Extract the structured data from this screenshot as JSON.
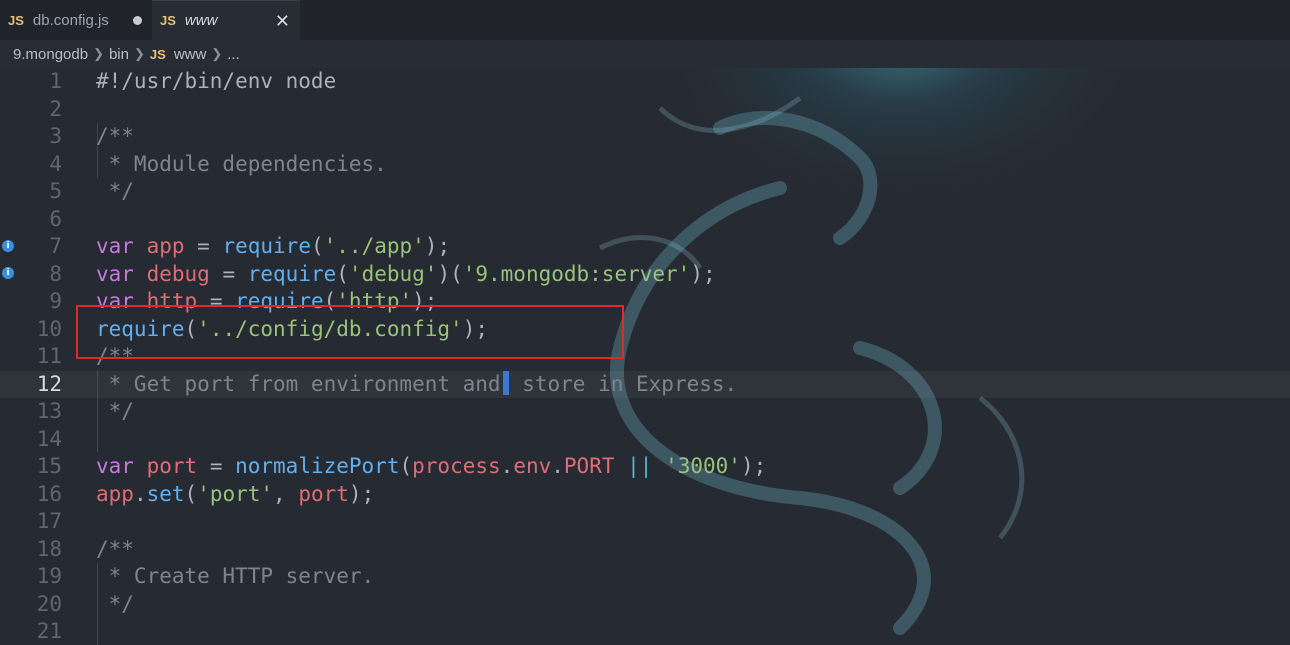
{
  "tabs": [
    {
      "badge": "JS",
      "label": "db.config.js",
      "dirty": true
    },
    {
      "badge": "JS",
      "label": "www",
      "active": true
    }
  ],
  "breadcrumb": {
    "items": [
      "9.mongodb",
      "bin",
      "www",
      "..."
    ],
    "file_badge": "JS"
  },
  "editor": {
    "current_line": 12,
    "lines": [
      {
        "n": "1",
        "text": "#!/usr/bin/env node"
      },
      {
        "n": "2",
        "text": ""
      },
      {
        "n": "3",
        "text": "/**"
      },
      {
        "n": "4",
        "text": " * Module dependencies."
      },
      {
        "n": "5",
        "text": " */"
      },
      {
        "n": "6",
        "text": ""
      },
      {
        "n": "7",
        "text": "var app = require('../app');"
      },
      {
        "n": "8",
        "text": "var debug = require('debug')('9.mongodb:server');"
      },
      {
        "n": "9",
        "text": "var http = require('http');"
      },
      {
        "n": "10",
        "text": "require('../config/db.config');"
      },
      {
        "n": "11",
        "text": "/**"
      },
      {
        "n": "12",
        "text": " * Get port from environment and store in Express."
      },
      {
        "n": "13",
        "text": " */"
      },
      {
        "n": "14",
        "text": ""
      },
      {
        "n": "15",
        "text": "var port = normalizePort(process.env.PORT || '3000');"
      },
      {
        "n": "16",
        "text": "app.set('port', port);"
      },
      {
        "n": "17",
        "text": ""
      },
      {
        "n": "18",
        "text": "/**"
      },
      {
        "n": "19",
        "text": " * Create HTTP server."
      },
      {
        "n": "20",
        "text": " */"
      },
      {
        "n": "21",
        "text": ""
      }
    ]
  },
  "colors": {
    "keyword": "#c678dd",
    "variable": "#e06c75",
    "function": "#61afef",
    "string": "#98c379",
    "comment": "#7f848e",
    "highlight_box": "#e02a2a",
    "cursor": "#3d78d8"
  },
  "icons": [
    "info-icon",
    "close-icon",
    "chevron-right-icon"
  ]
}
